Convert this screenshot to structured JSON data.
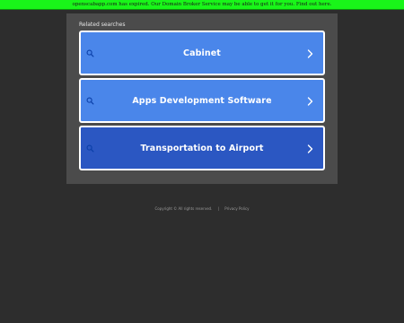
{
  "banner": {
    "text": "openscabapp.com has expired. Our Domain Broker Service may be able to get it for you. Find out here."
  },
  "panel": {
    "title": "Related searches",
    "items": [
      {
        "label": "Cabinet"
      },
      {
        "label": "Apps Development Software"
      },
      {
        "label": "Transportation to Airport"
      }
    ]
  },
  "footer": {
    "copyright": "Copyright ©  All rights reserved.",
    "separator": "|",
    "privacy": "Privacy Policy"
  },
  "colors": {
    "banner_bg": "#19f519",
    "page_bg": "#2d2d2d",
    "panel_bg": "#4b4b4b",
    "button_bg": "#4a86ea",
    "button_active_bg": "#2b57c2"
  },
  "icons": {
    "left": "search-icon",
    "right": "chevron-right-icon"
  }
}
